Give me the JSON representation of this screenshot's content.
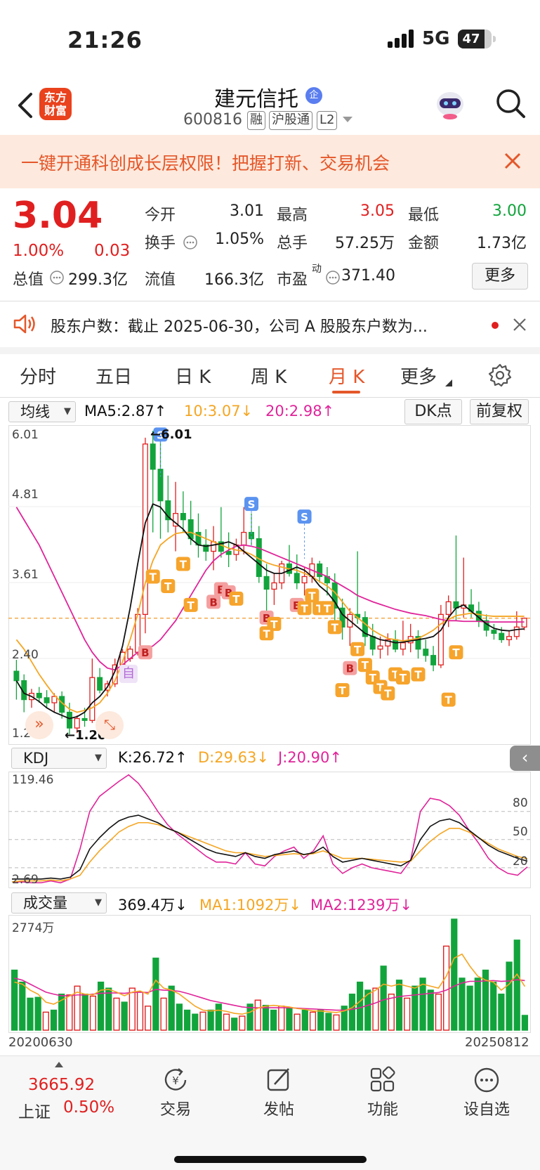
{
  "status_bar": {
    "time": "21:26",
    "network": "5G",
    "battery": "47"
  },
  "header": {
    "logo_line1": "东方",
    "logo_line2": "财富",
    "title": "建元信托",
    "verified_badge": "企",
    "code": "600816",
    "tags": [
      "融",
      "沪股通",
      "L2"
    ]
  },
  "banner": {
    "text": "一键开通科创成长层权限！把握打新、交易机会"
  },
  "quote": {
    "price": "3.04",
    "change_pct": "1.00%",
    "change": "0.03",
    "open_label": "今开",
    "open": "3.01",
    "high_label": "最高",
    "high": "3.05",
    "low_label": "最低",
    "low": "3.00",
    "turnover_label": "换手",
    "turnover": "1.05%",
    "volume_label": "总手",
    "volume": "57.25万",
    "amount_label": "金额",
    "amount": "1.73亿",
    "mktcap_label": "总值",
    "mktcap": "299.3亿",
    "float_label": "流值",
    "float": "166.3亿",
    "pe_label": "市盈",
    "pe_sup": "动",
    "pe": "371.40",
    "more_label": "更多"
  },
  "news": {
    "text": "股东户数：截止 2025-06-30，公司 A 股股东户数为..."
  },
  "tabs": {
    "items": [
      "分时",
      "五日",
      "日 K",
      "周 K",
      "月 K",
      "更多"
    ],
    "active": "月 K"
  },
  "kline": {
    "indicator_select": "均线",
    "ma5": "MA5:2.87↑",
    "ma10": "10:3.07↓",
    "ma20": "20:2.98↑",
    "dk_button": "DK点",
    "adjust_button": "前复权",
    "y_labels": [
      "6.01",
      "4.81",
      "3.61",
      "2.40",
      "1.20"
    ],
    "high_marker": "6.01",
    "low_marker": "1.20",
    "self_marker": "自",
    "colors": {
      "up": "#e02020",
      "down": "#12a43c",
      "ma5": "#111111",
      "ma10": "#f5a623",
      "ma20": "#e0249a",
      "signal": "#f39a2b"
    }
  },
  "kdj": {
    "indicator_select": "KDJ",
    "k": "K:26.72↑",
    "d": "D:29.63↓",
    "j": "J:20.90↑",
    "y_top": "119.46",
    "y_bottom": "2.69",
    "levels": [
      "80",
      "50",
      "20"
    ]
  },
  "volume": {
    "indicator_select": "成交量",
    "vol": "369.4万↓",
    "ma1": "MA1:1092万↓",
    "ma2": "MA2:1239万↓",
    "y_top": "2774万",
    "date_start": "20200630",
    "date_end": "20250812"
  },
  "bottom_bar": {
    "index_value": "3665.92",
    "index_name": "上证",
    "index_change": "0.50%",
    "items": [
      "交易",
      "发帖",
      "功能",
      "设自选"
    ]
  },
  "chart_data": {
    "type": "candlestick",
    "period": "monthly",
    "x_start": "20200630",
    "x_end": "20250812",
    "y_range": [
      1.2,
      6.01
    ],
    "candles": [
      {
        "o": 2.2,
        "h": 2.38,
        "l": 1.75,
        "c": 2.05
      },
      {
        "o": 2.05,
        "h": 2.15,
        "l": 1.55,
        "c": 1.75
      },
      {
        "o": 1.75,
        "h": 1.92,
        "l": 1.62,
        "c": 1.85
      },
      {
        "o": 1.85,
        "h": 1.95,
        "l": 1.7,
        "c": 1.78
      },
      {
        "o": 1.78,
        "h": 1.9,
        "l": 1.62,
        "c": 1.7
      },
      {
        "o": 1.7,
        "h": 1.85,
        "l": 1.55,
        "c": 1.8
      },
      {
        "o": 1.8,
        "h": 1.88,
        "l": 1.45,
        "c": 1.55
      },
      {
        "o": 1.55,
        "h": 1.7,
        "l": 1.2,
        "c": 1.3
      },
      {
        "o": 1.3,
        "h": 1.5,
        "l": 1.22,
        "c": 1.45
      },
      {
        "o": 1.45,
        "h": 1.62,
        "l": 1.32,
        "c": 1.42
      },
      {
        "o": 1.42,
        "h": 2.4,
        "l": 1.38,
        "c": 2.1
      },
      {
        "o": 2.1,
        "h": 2.25,
        "l": 1.85,
        "c": 1.9
      },
      {
        "o": 1.9,
        "h": 2.05,
        "l": 1.8,
        "c": 2.0
      },
      {
        "o": 2.0,
        "h": 2.4,
        "l": 1.95,
        "c": 2.3
      },
      {
        "o": 2.3,
        "h": 2.55,
        "l": 2.15,
        "c": 2.5
      },
      {
        "o": 2.4,
        "h": 2.6,
        "l": 2.35,
        "c": 2.55
      },
      {
        "o": 2.5,
        "h": 3.2,
        "l": 2.45,
        "c": 3.1
      },
      {
        "o": 3.1,
        "h": 5.9,
        "l": 2.8,
        "c": 5.8
      },
      {
        "o": 5.8,
        "h": 6.01,
        "l": 4.4,
        "c": 5.4
      },
      {
        "o": 5.4,
        "h": 6.01,
        "l": 4.3,
        "c": 4.9
      },
      {
        "o": 4.9,
        "h": 5.3,
        "l": 4.4,
        "c": 4.6
      },
      {
        "o": 4.5,
        "h": 5.2,
        "l": 4.1,
        "c": 4.7
      },
      {
        "o": 4.7,
        "h": 5.05,
        "l": 4.4,
        "c": 4.6
      },
      {
        "o": 4.6,
        "h": 4.9,
        "l": 4.2,
        "c": 4.3
      },
      {
        "o": 4.4,
        "h": 4.7,
        "l": 4.0,
        "c": 4.2
      },
      {
        "o": 4.2,
        "h": 4.45,
        "l": 3.95,
        "c": 4.1
      },
      {
        "o": 4.1,
        "h": 4.5,
        "l": 3.8,
        "c": 4.25
      },
      {
        "o": 4.25,
        "h": 4.8,
        "l": 4.0,
        "c": 4.1
      },
      {
        "o": 4.1,
        "h": 4.4,
        "l": 3.85,
        "c": 4.05
      },
      {
        "o": 4.05,
        "h": 4.3,
        "l": 3.95,
        "c": 4.2
      },
      {
        "o": 4.2,
        "h": 4.8,
        "l": 4.05,
        "c": 4.4
      },
      {
        "o": 4.4,
        "h": 4.7,
        "l": 4.2,
        "c": 4.3
      },
      {
        "o": 4.3,
        "h": 4.5,
        "l": 3.6,
        "c": 3.7
      },
      {
        "o": 3.7,
        "h": 3.9,
        "l": 3.1,
        "c": 3.5
      },
      {
        "o": 3.5,
        "h": 3.75,
        "l": 3.25,
        "c": 3.6
      },
      {
        "o": 3.6,
        "h": 3.95,
        "l": 3.5,
        "c": 3.9
      },
      {
        "o": 3.9,
        "h": 4.2,
        "l": 3.7,
        "c": 3.75
      },
      {
        "o": 3.75,
        "h": 4.05,
        "l": 3.5,
        "c": 3.6
      },
      {
        "o": 3.6,
        "h": 3.85,
        "l": 3.4,
        "c": 3.7
      },
      {
        "o": 3.7,
        "h": 4.0,
        "l": 3.6,
        "c": 3.9
      },
      {
        "o": 3.9,
        "h": 3.95,
        "l": 3.6,
        "c": 3.7
      },
      {
        "o": 3.7,
        "h": 3.85,
        "l": 3.4,
        "c": 3.6
      },
      {
        "o": 3.6,
        "h": 3.75,
        "l": 3.0,
        "c": 3.2
      },
      {
        "o": 3.2,
        "h": 3.35,
        "l": 2.7,
        "c": 2.9
      },
      {
        "o": 2.9,
        "h": 3.2,
        "l": 2.6,
        "c": 3.1
      },
      {
        "o": 3.1,
        "h": 4.1,
        "l": 2.95,
        "c": 3.05
      },
      {
        "o": 3.05,
        "h": 3.15,
        "l": 2.6,
        "c": 2.75
      },
      {
        "o": 2.75,
        "h": 2.95,
        "l": 2.45,
        "c": 2.55
      },
      {
        "o": 2.55,
        "h": 2.75,
        "l": 2.4,
        "c": 2.6
      },
      {
        "o": 2.6,
        "h": 2.8,
        "l": 2.45,
        "c": 2.7
      },
      {
        "o": 2.7,
        "h": 2.85,
        "l": 2.5,
        "c": 2.55
      },
      {
        "o": 2.55,
        "h": 3.0,
        "l": 2.45,
        "c": 2.65
      },
      {
        "o": 2.65,
        "h": 2.95,
        "l": 2.5,
        "c": 2.75
      },
      {
        "o": 2.75,
        "h": 2.85,
        "l": 2.4,
        "c": 2.55
      },
      {
        "o": 2.55,
        "h": 2.7,
        "l": 2.35,
        "c": 2.45
      },
      {
        "o": 2.45,
        "h": 2.6,
        "l": 2.2,
        "c": 2.3
      },
      {
        "o": 2.3,
        "h": 3.25,
        "l": 2.25,
        "c": 3.1
      },
      {
        "o": 3.1,
        "h": 3.4,
        "l": 2.9,
        "c": 3.3
      },
      {
        "o": 3.3,
        "h": 4.35,
        "l": 3.0,
        "c": 3.2
      },
      {
        "o": 3.2,
        "h": 4.0,
        "l": 3.05,
        "c": 3.25
      },
      {
        "o": 3.25,
        "h": 3.5,
        "l": 3.05,
        "c": 3.15
      },
      {
        "o": 3.15,
        "h": 3.3,
        "l": 2.9,
        "c": 3.0
      },
      {
        "o": 3.0,
        "h": 3.1,
        "l": 2.75,
        "c": 2.85
      },
      {
        "o": 2.85,
        "h": 2.95,
        "l": 2.7,
        "c": 2.8
      },
      {
        "o": 2.8,
        "h": 2.9,
        "l": 2.65,
        "c": 2.7
      },
      {
        "o": 2.7,
        "h": 2.85,
        "l": 2.6,
        "c": 2.75
      },
      {
        "o": 2.75,
        "h": 3.15,
        "l": 2.7,
        "c": 2.9
      },
      {
        "o": 2.9,
        "h": 3.05,
        "l": 2.85,
        "c": 3.04
      }
    ],
    "ma5": [
      2.05,
      1.85,
      1.8,
      1.72,
      1.62,
      1.55,
      1.5,
      1.45,
      1.48,
      1.55,
      1.7,
      1.8,
      1.95,
      2.2,
      2.6,
      3.2,
      3.9,
      4.55,
      4.85,
      4.8,
      4.65,
      4.55,
      4.45,
      4.3,
      4.2,
      4.18,
      4.2,
      4.22,
      4.25,
      4.2,
      4.1,
      4.0,
      3.9,
      3.8,
      3.75,
      3.75,
      3.8,
      3.85,
      3.8,
      3.7,
      3.55,
      3.45,
      3.3,
      3.1,
      3.0,
      2.9,
      2.8,
      2.75,
      2.7,
      2.68,
      2.65,
      2.66,
      2.68,
      2.7,
      2.72,
      2.75,
      2.85,
      3.05,
      3.2,
      3.25,
      3.15,
      3.05,
      2.95,
      2.88,
      2.85,
      2.84,
      2.86,
      2.87
    ],
    "ma10": [
      2.7,
      2.55,
      2.35,
      2.15,
      1.98,
      1.82,
      1.7,
      1.6,
      1.55,
      1.58,
      1.62,
      1.7,
      1.85,
      2.05,
      2.35,
      2.7,
      3.1,
      3.6,
      3.95,
      4.2,
      4.3,
      4.38,
      4.4,
      4.4,
      4.35,
      4.3,
      4.25,
      4.2,
      4.15,
      4.12,
      4.1,
      4.05,
      3.98,
      3.92,
      3.88,
      3.85,
      3.82,
      3.8,
      3.75,
      3.7,
      3.62,
      3.55,
      3.45,
      3.3,
      3.15,
      3.05,
      2.95,
      2.85,
      2.78,
      2.72,
      2.7,
      2.68,
      2.7,
      2.72,
      2.78,
      2.85,
      2.95,
      3.02,
      3.08,
      3.1,
      3.12,
      3.1,
      3.08,
      3.07,
      3.07,
      3.07,
      3.07,
      3.07
    ],
    "ma20": [
      4.8,
      4.6,
      4.4,
      4.2,
      3.95,
      3.7,
      3.45,
      3.2,
      2.95,
      2.7,
      2.5,
      2.35,
      2.25,
      2.22,
      2.3,
      2.4,
      2.5,
      2.55,
      2.6,
      2.7,
      2.85,
      3.0,
      3.2,
      3.4,
      3.6,
      3.8,
      3.95,
      4.05,
      4.12,
      4.18,
      4.2,
      4.18,
      4.15,
      4.1,
      4.05,
      4.0,
      3.95,
      3.9,
      3.85,
      3.8,
      3.75,
      3.7,
      3.62,
      3.55,
      3.48,
      3.4,
      3.35,
      3.3,
      3.26,
      3.22,
      3.18,
      3.15,
      3.12,
      3.1,
      3.08,
      3.05,
      3.02,
      3.0,
      3.0,
      2.99,
      2.99,
      2.99,
      2.98,
      2.98,
      2.98,
      2.98,
      2.98,
      2.98
    ],
    "kdj": {
      "range": [
        2.69,
        119.46
      ],
      "k": [
        8,
        8,
        8,
        8,
        9,
        8,
        10,
        18,
        40,
        52,
        62,
        70,
        74,
        76,
        72,
        68,
        62,
        58,
        52,
        46,
        40,
        36,
        34,
        32,
        36,
        32,
        30,
        34,
        36,
        38,
        34,
        36,
        42,
        32,
        26,
        28,
        30,
        28,
        26,
        24,
        22,
        28,
        50,
        64,
        70,
        72,
        68,
        60,
        52,
        44,
        38,
        34,
        30,
        27
      ],
      "d": [
        5,
        6,
        6,
        6,
        7,
        6,
        8,
        12,
        26,
        38,
        48,
        58,
        64,
        68,
        68,
        66,
        62,
        58,
        54,
        50,
        46,
        42,
        38,
        36,
        36,
        34,
        32,
        33,
        34,
        35,
        34,
        35,
        38,
        34,
        30,
        30,
        30,
        29,
        28,
        27,
        26,
        27,
        38,
        48,
        56,
        62,
        62,
        58,
        52,
        46,
        40,
        36,
        32,
        29.6
      ],
      "j": [
        5,
        5,
        4,
        4,
        6,
        4,
        8,
        40,
        80,
        96,
        104,
        112,
        119,
        110,
        96,
        80,
        66,
        56,
        48,
        40,
        32,
        26,
        26,
        24,
        36,
        24,
        22,
        32,
        38,
        42,
        30,
        38,
        54,
        24,
        14,
        20,
        24,
        20,
        18,
        16,
        14,
        28,
        80,
        94,
        92,
        86,
        76,
        60,
        46,
        30,
        20,
        14,
        12,
        20.9
      ]
    },
    "volume_series": [
      1500,
      1200,
      800,
      820,
      450,
      500,
      900,
      880,
      1100,
      900,
      850,
      1200,
      1050,
      800,
      700,
      1050,
      950,
      600,
      1800,
      800,
      1100,
      650,
      500,
      400,
      450,
      500,
      650,
      400,
      300,
      350,
      650,
      750,
      620,
      500,
      600,
      550,
      400,
      500,
      450,
      500,
      420,
      380,
      600,
      900,
      1200,
      1000,
      1050,
      1600,
      900,
      1250,
      800,
      1100,
      1300,
      1000,
      900,
      2100,
      2774,
      1300,
      1100,
      1300,
      1500,
      1200,
      900,
      1700,
      2250,
      369.4
    ],
    "volume_up": [
      false,
      false,
      false,
      false,
      true,
      false,
      false,
      true,
      true,
      false,
      true,
      false,
      false,
      true,
      false,
      true,
      true,
      true,
      false,
      true,
      false,
      false,
      false,
      false,
      true,
      false,
      false,
      true,
      false,
      true,
      false,
      true,
      false,
      false,
      true,
      false,
      true,
      false,
      true,
      false,
      false,
      true,
      false,
      false,
      false,
      false,
      true,
      false,
      true,
      false,
      true,
      false,
      false,
      false,
      true,
      true,
      false,
      false,
      false,
      false,
      false,
      false,
      false,
      false,
      false,
      false,
      false
    ],
    "vol_ma1": [
      1200,
      1150,
      1000,
      900,
      700,
      650,
      750,
      850,
      950,
      900,
      880,
      1000,
      1020,
      950,
      860,
      950,
      980,
      900,
      1250,
      1050,
      1000,
      900,
      750,
      600,
      500,
      480,
      500,
      470,
      420,
      400,
      450,
      550,
      600,
      620,
      600,
      580,
      540,
      520,
      480,
      480,
      460,
      440,
      480,
      560,
      720,
      900,
      1000,
      1150,
      1100,
      1150,
      1100,
      1050,
      1150,
      1100,
      1050,
      1350,
      1800,
      1900,
      1600,
      1350,
      1250,
      1200,
      1000,
      1150,
      1400,
      1092
    ],
    "vol_ma2": [
      1300,
      1250,
      1150,
      1050,
      950,
      900,
      860,
      860,
      880,
      880,
      900,
      920,
      930,
      930,
      920,
      940,
      950,
      940,
      1020,
      1000,
      990,
      970,
      920,
      860,
      800,
      740,
      700,
      660,
      620,
      580,
      560,
      560,
      560,
      560,
      560,
      560,
      550,
      540,
      530,
      520,
      510,
      500,
      500,
      520,
      560,
      620,
      680,
      760,
      800,
      840,
      860,
      880,
      900,
      920,
      940,
      1000,
      1100,
      1180,
      1220,
      1220,
      1230,
      1240,
      1220,
      1230,
      1260,
      1239
    ]
  }
}
